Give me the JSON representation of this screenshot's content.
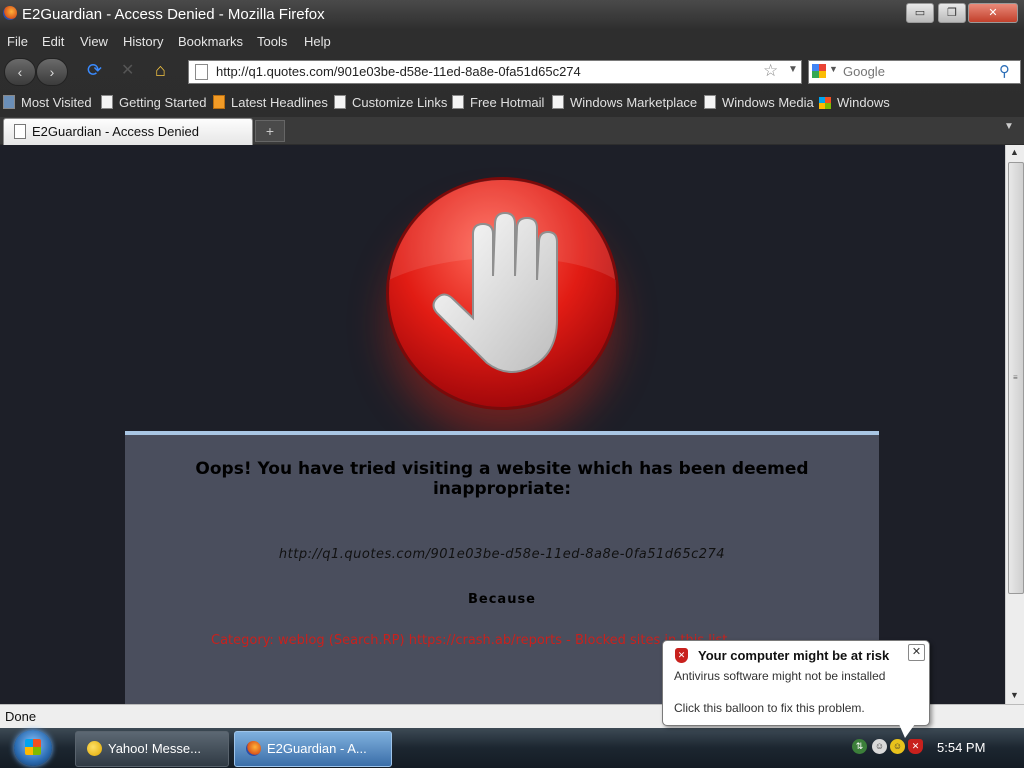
{
  "window": {
    "title": "E2Guardian - Access Denied - Mozilla Firefox",
    "minimize_glyph": "▭",
    "maximize_glyph": "❐",
    "close_glyph": "✕"
  },
  "menubar": {
    "items": [
      "File",
      "Edit",
      "View",
      "History",
      "Bookmarks",
      "Tools",
      "Help"
    ]
  },
  "navbar": {
    "back_glyph": "‹",
    "forward_glyph": "›",
    "url": "http://q1.quotes.com/901e03be-d58e-11ed-8a8e-0fa51d65c274",
    "search_placeholder": "Google"
  },
  "bookmarks": [
    "Most Visited",
    "Getting Started",
    "Latest Headlines",
    "Customize Links",
    "Free Hotmail",
    "Windows Marketplace",
    "Windows Media",
    "Windows"
  ],
  "tabs": {
    "active_label": "E2Guardian - Access Denied",
    "new_tab_glyph": "+"
  },
  "page": {
    "heading": "Oops! You have tried visiting a website which has been deemed inappropriate:",
    "blocked_url": "http://q1.quotes.com/901e03be-d58e-11ed-8a8e-0fa51d65c274",
    "because_label": "Because",
    "reason": "Category: weblog (Search.RP) https://crash.ab/reports - Blocked sites in this list"
  },
  "status": {
    "text": "Done"
  },
  "balloon": {
    "title": "Your computer might be at risk",
    "line1": "Antivirus software might not be installed",
    "line2": "Click this balloon to fix this problem.",
    "close_glyph": "✕"
  },
  "taskbar": {
    "items": [
      "Yahoo! Messe...",
      "E2Guardian - A..."
    ],
    "clock": "5:54 PM"
  },
  "colors": {
    "page_background": "#1d1f28",
    "message_box": "#4a4e5d",
    "reason_text": "#c8211d",
    "stop_sign_red": "#e11c14"
  },
  "icons": [
    "firefox-logo",
    "back-arrow-icon",
    "forward-arrow-icon",
    "reload-icon",
    "stop-icon",
    "home-icon",
    "bookmark-star-icon",
    "google-icon",
    "magnifier-icon",
    "stop-hand-icon",
    "shield-icon",
    "windows-logo"
  ]
}
